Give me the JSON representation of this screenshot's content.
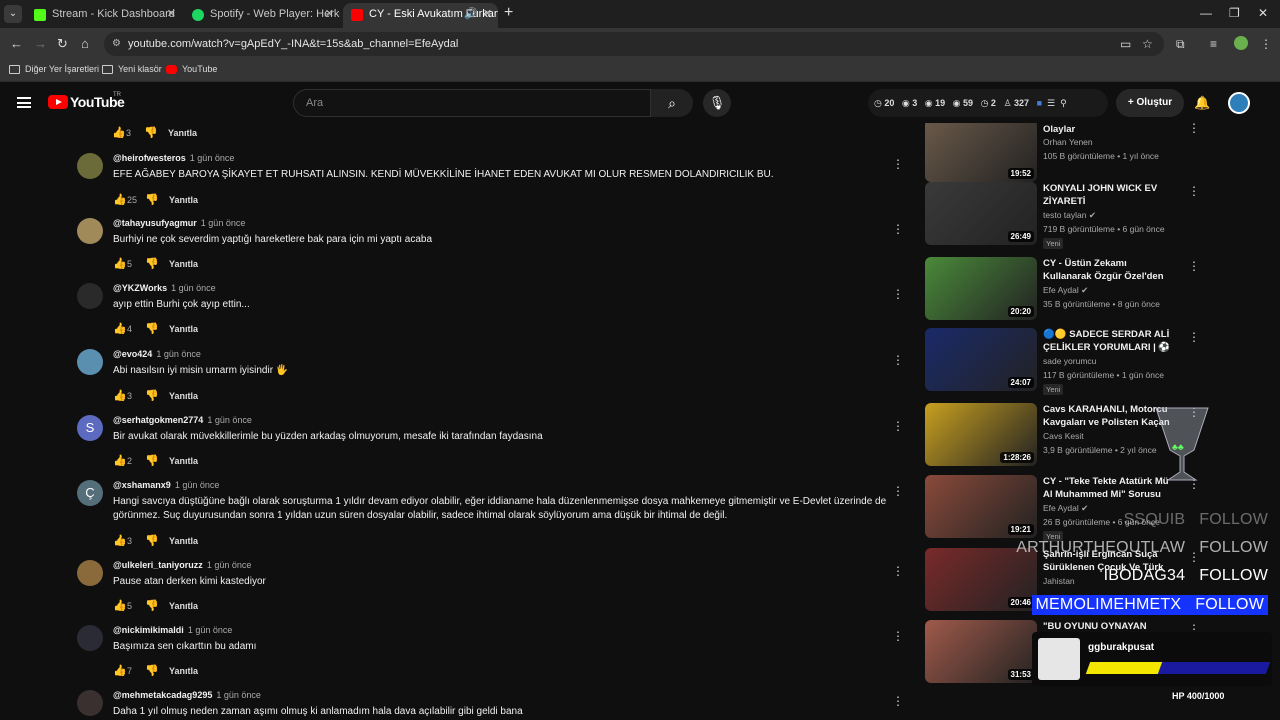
{
  "tabs": [
    {
      "title": "Stream - Kick Dashboard",
      "color": "#53fc18"
    },
    {
      "title": "Spotify - Web Player: Herkes için",
      "color": "#1ed760"
    },
    {
      "title": "CY - Eski Avukatım Furkan'a ...",
      "color": "#ff0000"
    }
  ],
  "address": {
    "url": "youtube.com/watch?v=gApEdY_-INA&t=15s&ab_channel=EfeAydal"
  },
  "bookmarks": [
    "Diğer Yer İşaretleri",
    "Yeni klasör",
    "YouTube"
  ],
  "header": {
    "logo": "YouTube",
    "region": "TR",
    "search_placeholder": "Ara",
    "stats": [
      "20",
      "3",
      "19",
      "59",
      "2",
      "327"
    ],
    "create_label": "Oluştur"
  },
  "top_actions": {
    "likes": "3",
    "reply": "Yanıtla"
  },
  "comments": [
    {
      "author": "@heirofwesteros",
      "time": "1 gün önce",
      "text": "EFE AĞABEY BAROYA ŞİKAYET ET RUHSATI ALINSIN. KENDİ MÜVEKKİLİNE İHANET EDEN AVUKAT MI OLUR RESMEN DOLANDIRICILIK BU.",
      "likes": "25",
      "reply": "Yanıtla",
      "avatar_color": "#6b6b3a"
    },
    {
      "author": "@tahayusufyagmur",
      "time": "1 gün önce",
      "text": "Burhiyi ne çok severdim yaptığı hareketlere bak para için mi yaptı acaba",
      "likes": "5",
      "reply": "Yanıtla",
      "avatar_color": "#a08a5a"
    },
    {
      "author": "@YKZWorks",
      "time": "1 gün önce",
      "text": "ayıp ettin Burhi çok ayıp ettin...",
      "likes": "4",
      "reply": "Yanıtla",
      "avatar_color": "#2a2a2a"
    },
    {
      "author": "@evo424",
      "time": "1 gün önce",
      "text": "Abi nasılsın iyi misin umarm iyisindir 🖐",
      "likes": "3",
      "reply": "Yanıtla",
      "avatar_color": "#5a8fb0"
    },
    {
      "author": "@serhatgokmen2774",
      "time": "1 gün önce",
      "text": "Bir avukat olarak müvekkillerimle bu yüzden arkadaş olmuyorum, mesafe iki tarafından faydasına",
      "likes": "2",
      "reply": "Yanıtla",
      "avatar_color": "#5c6bc0",
      "initial": "S"
    },
    {
      "author": "@xshamanx9",
      "time": "1 gün önce",
      "text": "Hangi savcıya düştüğüne bağlı olarak soruşturma 1 yıldır devam ediyor olabilir, eğer iddianame hala düzenlenmemişse dosya mahkemeye gitmemiştir ve E-Devlet üzerinde de görünmez. Suç duyurusundan sonra 1 yıldan uzun süren dosyalar olabilir, sadece ihtimal olarak söylüyorum ama düşük bir ihtimal de değil.",
      "likes": "3",
      "reply": "Yanıtla",
      "avatar_color": "#546e7a",
      "initial": "Ç"
    },
    {
      "author": "@ulkeleri_taniyoruzz",
      "time": "1 gün önce",
      "text": "Pause atan derken kimi kastediyor",
      "likes": "5",
      "reply": "Yanıtla",
      "avatar_color": "#8a6a3a"
    },
    {
      "author": "@nickimikimaldi",
      "time": "1 gün önce",
      "text": "Başımıza sen cıkarttın bu adamı",
      "likes": "7",
      "reply": "Yanıtla",
      "avatar_color": "#2b2b35"
    },
    {
      "author": "@mehmetakcadag9295",
      "time": "1 gün önce",
      "text": "Daha 1 yıl olmuş neden zaman aşımı olmuş ki anlamadım hala dava açılabilir gibi geldi bana",
      "likes": "",
      "reply": "",
      "avatar_color": "#3a3030"
    }
  ],
  "sidebar": [
    {
      "title": "Olaylar",
      "channel": "Orhan Yenen",
      "meta": "105 B görüntüleme • 1 yıl önce",
      "duration": "19:52",
      "new": "",
      "thumb": "#6b5a4a"
    },
    {
      "title": "KONYALI JOHN WICK EV ZİYARETİ",
      "channel": "testo taylan ✔",
      "meta": "719 B görüntüleme • 6 gün önce",
      "duration": "26:49",
      "new": "Yeni",
      "thumb": "#3a3a3a"
    },
    {
      "title": "CY - Üstün Zekamı Kullanarak Özgür Özel'den Cacık ...",
      "channel": "Efe Aydal ✔",
      "meta": "35 B görüntüleme • 8 gün önce",
      "duration": "20:20",
      "new": "",
      "thumb": "#4a8a3a"
    },
    {
      "title": "🔵🟡 SADECE SERDAR ALİ ÇELİKLER YORUMLARI | ⚽ ...",
      "channel": "sade yorumcu",
      "meta": "117 B görüntüleme • 1 gün önce",
      "duration": "24:07",
      "new": "Yeni",
      "thumb": "#1a2a6a"
    },
    {
      "title": "Cavs KARAHANLI, Motorcu Kavgaları ve Polisten Kaçan ...",
      "channel": "Cavs Kesit",
      "meta": "3,9 B görüntüleme • 2 yıl önce",
      "duration": "1:28:26",
      "new": "",
      "thumb": "#c8a020"
    },
    {
      "title": "CY - \"Teke Tekte Atatürk Mü Al Muhammed Mi\" Sorusu",
      "channel": "Efe Aydal ✔",
      "meta": "26 B görüntüleme • 6 gün önce",
      "duration": "19:21",
      "new": "Yeni",
      "thumb": "#8a4a3a"
    },
    {
      "title": "Şahrin-işli Ergincan Suça Sürüklenen Çocuk Ve Türk De...",
      "channel": "Jahistan",
      "meta": "",
      "duration": "20:46",
      "new": "",
      "thumb": "#7a2a2a"
    },
    {
      "title": "\"BU OYUNU OYNAYAN",
      "channel": "",
      "meta": "",
      "duration": "31:53",
      "new": "",
      "thumb": "#a05a4a"
    }
  ],
  "overlay": {
    "follows": [
      {
        "name": "SSQUIB",
        "action": "FOLLOW"
      },
      {
        "name": "ARTHURTHEOUTLAW",
        "action": "FOLLOW"
      },
      {
        "name": "IBODAG34",
        "action": "FOLLOW"
      },
      {
        "name": "MEMOLIMEHMETX",
        "action": "FOLLOW"
      }
    ],
    "goal_name": "ggburakpusat",
    "hp_text": "HP 400/1000",
    "hp_fraction": 0.4
  }
}
